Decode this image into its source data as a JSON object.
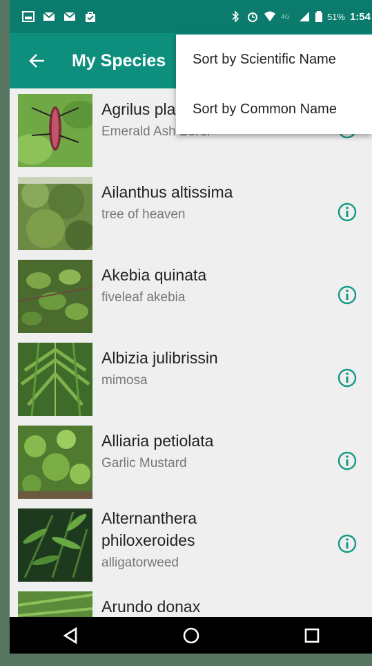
{
  "status_bar": {
    "battery": "51%",
    "time": "1:54"
  },
  "app_bar": {
    "title": "My Species"
  },
  "menu": {
    "items": [
      "Sort by Scientific Name",
      "Sort by Common Name"
    ]
  },
  "species": [
    {
      "scientific": "Agrilus planipennis",
      "common": "Emerald Ash Borer"
    },
    {
      "scientific": "Ailanthus altissima",
      "common": "tree of heaven"
    },
    {
      "scientific": "Akebia quinata",
      "common": "fiveleaf akebia"
    },
    {
      "scientific": "Albizia julibrissin",
      "common": "mimosa"
    },
    {
      "scientific": "Alliaria petiolata",
      "common": "Garlic Mustard"
    },
    {
      "scientific": "Alternanthera philoxeroides",
      "common": "alligatorweed"
    },
    {
      "scientific": "Arundo donax",
      "common": ""
    }
  ],
  "colors": {
    "primary": "#0e8f7e",
    "status": "#0a7b6c",
    "accent": "#129a86"
  }
}
